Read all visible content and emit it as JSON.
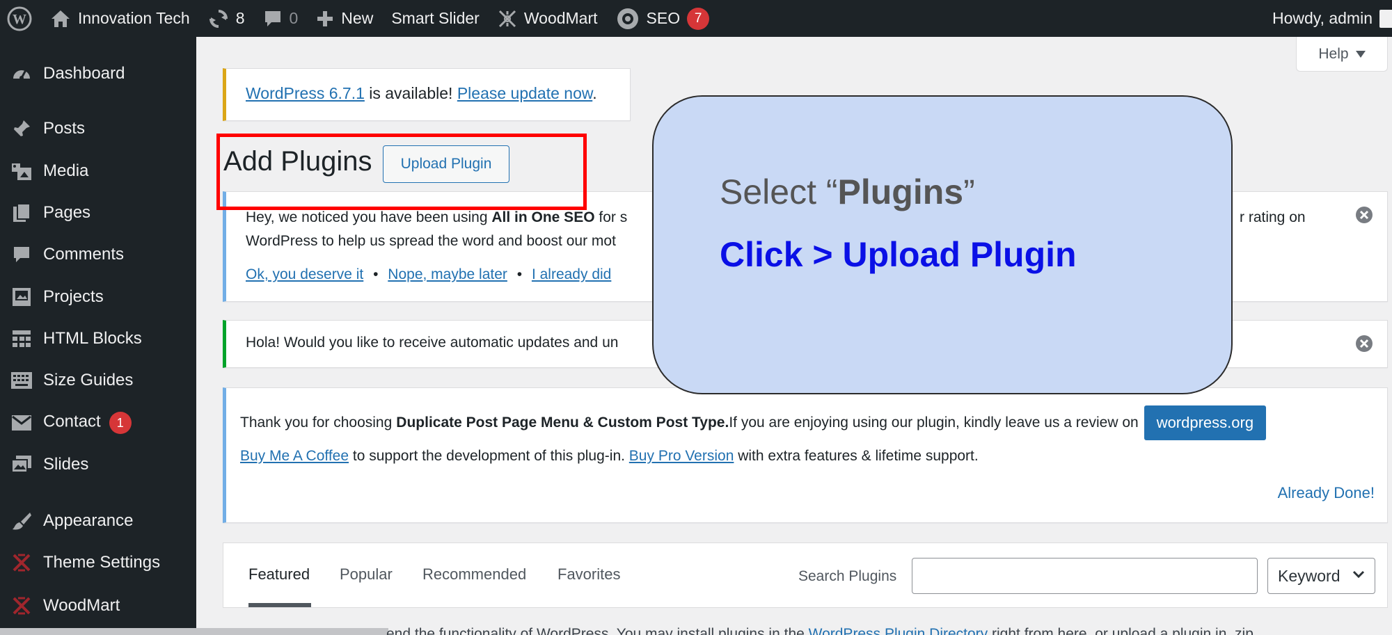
{
  "admin_bar": {
    "site_name": "Innovation Tech",
    "updates_count": "8",
    "comments_count": "0",
    "new_label": "New",
    "smart_slider_label": "Smart Slider",
    "woodmart_label": "WoodMart",
    "seo_label": "SEO",
    "seo_badge": "7",
    "greeting": "Howdy, admin"
  },
  "help_tab": {
    "label": "Help"
  },
  "sidebar": {
    "items": [
      {
        "label": "Dashboard",
        "icon": "dashboard-icon"
      },
      {
        "label": "Posts",
        "icon": "pin-icon"
      },
      {
        "label": "Media",
        "icon": "media-icon"
      },
      {
        "label": "Pages",
        "icon": "pages-icon"
      },
      {
        "label": "Comments",
        "icon": "comment-icon"
      },
      {
        "label": "Projects",
        "icon": "projects-icon"
      },
      {
        "label": "HTML Blocks",
        "icon": "blocks-icon"
      },
      {
        "label": "Size Guides",
        "icon": "keyboard-icon"
      },
      {
        "label": "Contact",
        "icon": "mail-icon",
        "badge": "1"
      },
      {
        "label": "Slides",
        "icon": "slides-icon"
      },
      {
        "label": "Appearance",
        "icon": "brush-icon"
      },
      {
        "label": "Theme Settings",
        "icon": "woodmart-icon"
      },
      {
        "label": "WoodMart",
        "icon": "woodmart-icon"
      }
    ]
  },
  "update_notice": {
    "version_link": "WordPress 6.7.1",
    "text": " is available! ",
    "update_link": "Please update now",
    "period": "."
  },
  "page": {
    "title": "Add Plugins",
    "upload_button": "Upload Plugin"
  },
  "aioseo_notice": {
    "text_start": "Hey, we noticed you have been using ",
    "plugin_name": "All in One SEO",
    "text_after": " for s",
    "text_right": "r rating on",
    "line2": "WordPress to help us spread the word and boost our mot",
    "link1": "Ok, you deserve it",
    "link2": "Nope, maybe later",
    "link3": "I already did",
    "separator": "•"
  },
  "hola_notice": {
    "text": "Hola! Would you like to receive automatic updates and un"
  },
  "dup_notice": {
    "text_start": "Thank you for choosing ",
    "plugin_name": "Duplicate Post Page Menu & Custom Post Type.",
    "text_end": " If you are enjoying using our plugin, kindly leave us a review on",
    "button": "wordpress.org",
    "coffee_link": "Buy Me A Coffee",
    "mid_text": " to support the development of this plug-in. ",
    "pro_link": "Buy Pro Version",
    "end_text": " with extra features & lifetime support.",
    "done_link": "Already Done!"
  },
  "filter_bar": {
    "tabs": [
      "Featured",
      "Popular",
      "Recommended",
      "Favorites"
    ],
    "search_label": "Search Plugins",
    "search_value": "",
    "select_value": "Keyword"
  },
  "bottom": {
    "text_start": "end the functionality of WordPress. You may install plugins in the ",
    "link": "WordPress Plugin Directory",
    "text_end": " right from here, or upload a plugin in .zip"
  },
  "callout": {
    "line1_prefix": "Select “",
    "line1_bold": "Plugins",
    "line1_suffix": "”",
    "line2": "Click > Upload Plugin"
  },
  "colors": {
    "admin_bar": "#1d2327",
    "link": "#2271b1",
    "badge": "#d63638",
    "highlight": "#ff0000",
    "callout_bg": "#c9d9f5",
    "callout_text": "#0a10e6"
  }
}
